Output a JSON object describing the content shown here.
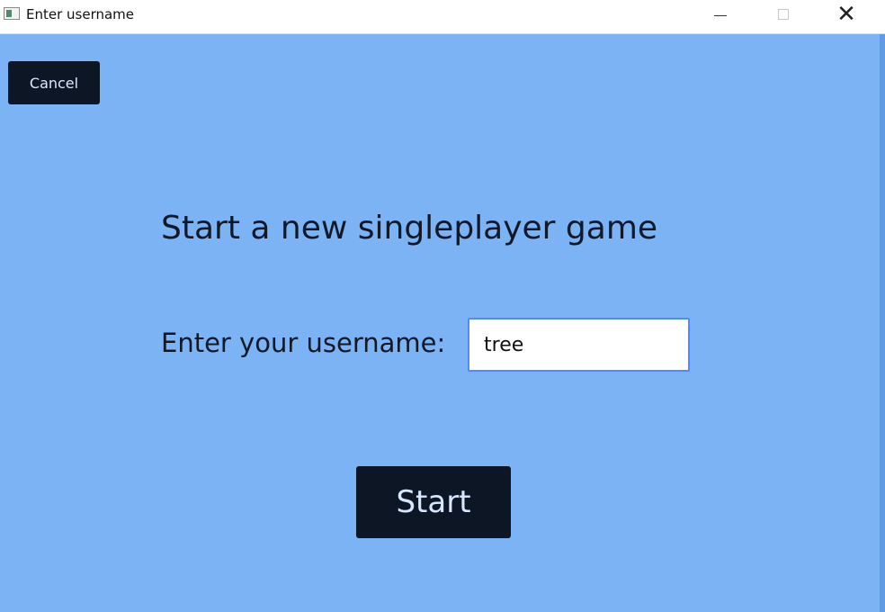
{
  "window": {
    "title": "Enter username"
  },
  "titlebar": {
    "icons": {
      "app": "app-window-icon",
      "minimize": "minimize-icon",
      "maximize": "maximize-icon",
      "close": "close-icon"
    },
    "minimize_label": "—",
    "maximize_label": "□",
    "close_label": "✕"
  },
  "actions": {
    "cancel_label": "Cancel",
    "start_label": "Start"
  },
  "main": {
    "title": "Start a new singleplayer game",
    "username_label": "Enter your username:",
    "username_value": "tree"
  },
  "colors": {
    "background": "#7bb3f5",
    "button": "#0d1624",
    "input_border": "#4f8bff"
  }
}
